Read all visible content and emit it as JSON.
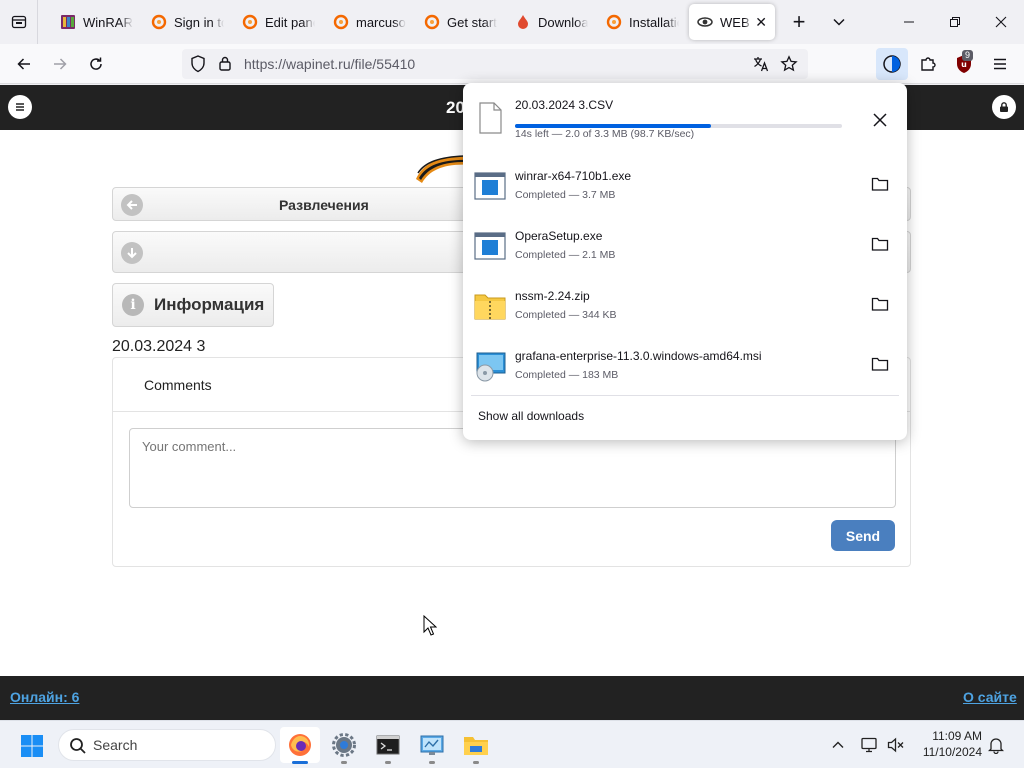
{
  "browser": {
    "tabs": [
      {
        "title": "WinRAR",
        "icon": "winrar-icon"
      },
      {
        "title": "Sign in to",
        "icon": "grafana-icon"
      },
      {
        "title": "Edit panel",
        "icon": "grafana-icon"
      },
      {
        "title": "marcusolsson",
        "icon": "grafana-icon"
      },
      {
        "title": "Get started",
        "icon": "grafana-icon"
      },
      {
        "title": "Download",
        "icon": "download-icon"
      },
      {
        "title": "Installation",
        "icon": "grafana-icon"
      },
      {
        "title": "WEB",
        "icon": "wapinet-icon",
        "active": true
      }
    ],
    "url": "https://wapinet.ru/file/55410",
    "ublock_badge": "9"
  },
  "site": {
    "title": "20",
    "nav": {
      "category": "Развлечения",
      "info_label": "Информация"
    },
    "file_name": "20.03.2024 3",
    "comments": {
      "title": "Comments",
      "placeholder": "Your comment...",
      "send_label": "Send"
    },
    "footer": {
      "online": "Онлайн: 6",
      "about": "О сайте"
    }
  },
  "downloads": {
    "items": [
      {
        "name": "20.03.2024 3.CSV",
        "status": "14s left — 2.0 of 3.3 MB (98.7 KB/sec)",
        "in_progress": true,
        "progress": 0.6,
        "icon": "file-icon"
      },
      {
        "name": "winrar-x64-710b1.exe",
        "status": "Completed — 3.7 MB",
        "icon": "exe-icon"
      },
      {
        "name": "OperaSetup.exe",
        "status": "Completed — 2.1 MB",
        "icon": "exe-icon"
      },
      {
        "name": "nssm-2.24.zip",
        "status": "Completed — 344 KB",
        "icon": "zip-folder-icon"
      },
      {
        "name": "grafana-enterprise-11.3.0.windows-amd64.msi",
        "status": "Completed — 183 MB",
        "icon": "msi-installer-icon"
      }
    ],
    "show_all": "Show all downloads"
  },
  "taskbar": {
    "search_placeholder": "Search",
    "time": "11:09 AM",
    "date": "11/10/2024"
  },
  "colors": {
    "accent": "#0061e0",
    "site_dark": "#222222",
    "send_button": "#4a7fbf",
    "footer_link": "#4ea3e2"
  }
}
